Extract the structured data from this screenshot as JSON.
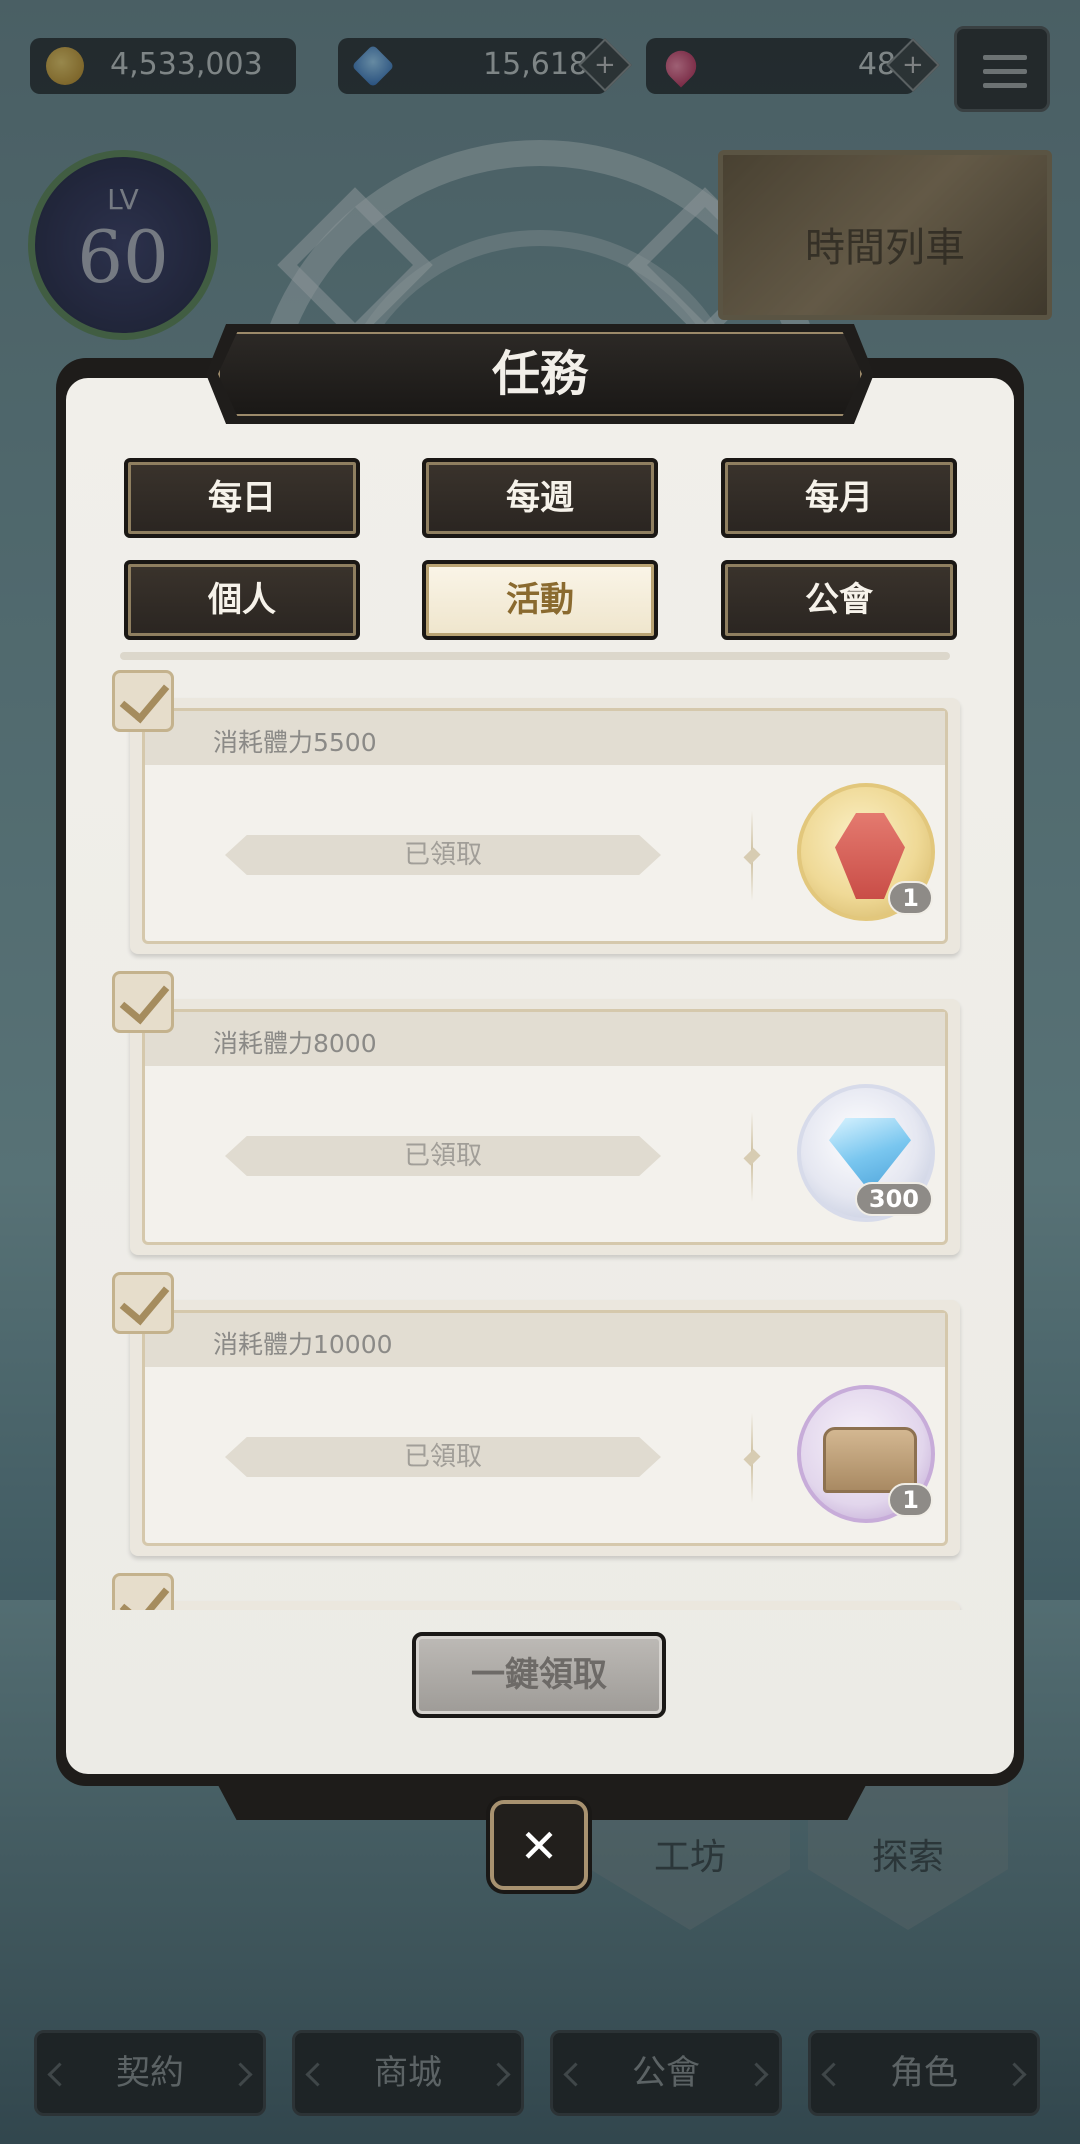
{
  "currency": {
    "gold": "4,533,003",
    "gems": "15,618",
    "rubies": "48",
    "plus": "+"
  },
  "player": {
    "level_label": "LV",
    "level": "60"
  },
  "event_banner": {
    "text": "時間列車"
  },
  "modal": {
    "title": "任務",
    "tabs": [
      "每日",
      "每週",
      "每月",
      "個人",
      "活動",
      "公會"
    ],
    "active_tab": "活動",
    "tasks": [
      {
        "name": "消耗體力5500",
        "status": "已領取",
        "reward": "lantern",
        "count": "1"
      },
      {
        "name": "消耗體力8000",
        "status": "已領取",
        "reward": "gem",
        "count": "300"
      },
      {
        "name": "消耗體力10000",
        "status": "已領取",
        "reward": "chest",
        "count": "1"
      }
    ],
    "claim_all": "一鍵領取",
    "close": "✕"
  },
  "scene_buttons": {
    "workshop": "工坊",
    "explore": "探索"
  },
  "bottom_nav": [
    "契約",
    "商城",
    "公會",
    "角色"
  ],
  "colors": {
    "modal_bg": "#f1efea",
    "frame": "#1e1c1a",
    "accent_gold": "#a58c5e",
    "active_tab_text": "#8a6a2f"
  }
}
